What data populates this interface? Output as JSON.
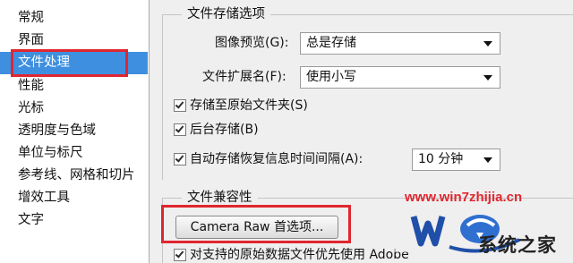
{
  "sidebar": {
    "items": [
      {
        "label": "常规"
      },
      {
        "label": "界面"
      },
      {
        "label": "文件处理",
        "selected": true
      },
      {
        "label": "性能"
      },
      {
        "label": "光标"
      },
      {
        "label": "透明度与色域"
      },
      {
        "label": "单位与标尺"
      },
      {
        "label": "参考线、网格和切片"
      },
      {
        "label": "增效工具"
      },
      {
        "label": "文字"
      }
    ]
  },
  "file_saving": {
    "title": "文件存储选项",
    "image_preview_label": "图像预览(G):",
    "image_preview_value": "总是存储",
    "extension_label": "文件扩展名(F):",
    "extension_value": "使用小写",
    "save_to_original_label": "存储至原始文件夹(S)",
    "save_to_original_checked": true,
    "background_save_label": "后台存储(B)",
    "background_save_checked": true,
    "auto_save_label": "自动存储恢复信息时间间隔(A):",
    "auto_save_checked": true,
    "auto_save_interval": "10 分钟"
  },
  "compatibility": {
    "title": "文件兼容性",
    "camera_raw_button": "Camera Raw 首选项...",
    "prefer_raw_label": "对支持的原始数据文件优先使用 Adobe",
    "prefer_raw_checked": true
  },
  "watermark": {
    "url": "www.win7zhijia.cn",
    "name": "系统之家"
  },
  "colors": {
    "selection": "#3f8fe0",
    "highlight_box": "#e0262f"
  }
}
